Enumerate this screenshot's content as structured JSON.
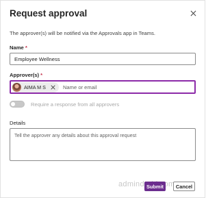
{
  "dialog": {
    "title": "Request approval",
    "description": "The approver(s) will be notified via the Approvals app in Teams.",
    "close_icon": "close-icon"
  },
  "name_field": {
    "label": "Name",
    "required_mark": "*",
    "value": "Employee Wellness"
  },
  "approvers_field": {
    "label": "Approver(s)",
    "required_mark": "*",
    "chips": [
      {
        "name": "AIMA M S",
        "avatar_icon": "avatar",
        "remove_icon": "close-icon"
      }
    ],
    "placeholder": "Name or email"
  },
  "require_all": {
    "label": "Require a response from all approvers",
    "enabled": false
  },
  "details_field": {
    "label": "Details",
    "placeholder": "Tell the approver any details about this approval request"
  },
  "buttons": {
    "submit": "Submit",
    "cancel": "Cancel"
  },
  "watermark": "admindroid.com",
  "colors": {
    "accent": "#6b2d8e",
    "focus_border": "#8c2aa8",
    "required": "#c4314b"
  }
}
